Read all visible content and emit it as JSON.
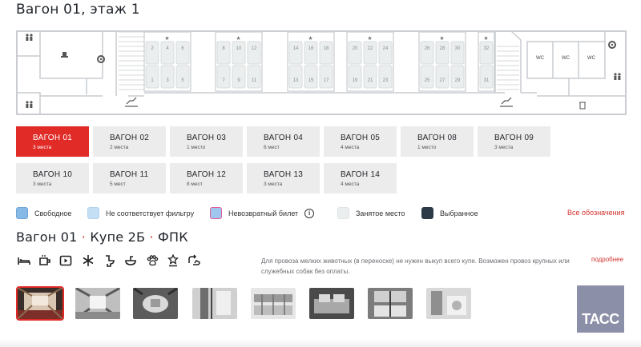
{
  "header": {
    "title": "Вагон 01, этаж 1"
  },
  "car_map": {
    "compartments": [
      {
        "top_seats": [
          "2",
          "4",
          "6"
        ],
        "bottom_seats": [
          "1",
          "3",
          "5"
        ]
      },
      {
        "top_seats": [
          "8",
          "10",
          "12"
        ],
        "bottom_seats": [
          "7",
          "9",
          "11"
        ]
      },
      {
        "top_seats": [
          "14",
          "16",
          "18"
        ],
        "bottom_seats": [
          "13",
          "15",
          "17"
        ]
      },
      {
        "top_seats": [
          "20",
          "22",
          "24"
        ],
        "bottom_seats": [
          "19",
          "21",
          "23"
        ]
      },
      {
        "top_seats": [
          "26",
          "28",
          "30"
        ],
        "bottom_seats": [
          "25",
          "27",
          "29"
        ]
      },
      {
        "top_seats": [
          "32"
        ],
        "bottom_seats": [
          "31"
        ]
      }
    ],
    "wc_labels": [
      "WC",
      "WC",
      "WC"
    ]
  },
  "wagons": [
    {
      "name": "ВАГОН 01",
      "seats": "3 места",
      "active": true
    },
    {
      "name": "ВАГОН 02",
      "seats": "2 места",
      "active": false
    },
    {
      "name": "ВАГОН 03",
      "seats": "1 место",
      "active": false
    },
    {
      "name": "ВАГОН 04",
      "seats": "6 мест",
      "active": false
    },
    {
      "name": "ВАГОН 05",
      "seats": "4 места",
      "active": false
    },
    {
      "name": "ВАГОН 08",
      "seats": "1 место",
      "active": false
    },
    {
      "name": "ВАГОН 09",
      "seats": "3 места",
      "active": false
    },
    {
      "name": "ВАГОН 10",
      "seats": "3 места",
      "active": false
    },
    {
      "name": "ВАГОН 11",
      "seats": "5 мест",
      "active": false
    },
    {
      "name": "ВАГОН 12",
      "seats": "8 мест",
      "active": false
    },
    {
      "name": "ВАГОН 13",
      "seats": "3 места",
      "active": false
    },
    {
      "name": "ВАГОН 14",
      "seats": "4 места",
      "active": false
    }
  ],
  "legend": {
    "items": [
      {
        "label": "Свободное",
        "color": "#86b9e6",
        "border": "#6fa4d6"
      },
      {
        "label": "Не соответствует фильтру",
        "color": "#c4def4",
        "border": "#b2d1ec"
      },
      {
        "label": "Невозвратный билет",
        "color": "#9fc6ec",
        "border": "#e35aa0"
      },
      {
        "label": "Занятое место",
        "color": "#ebeeee",
        "border": "#e0e3e3"
      },
      {
        "label": "Выбранное",
        "color": "#2c3a47",
        "border": "#2c3a47"
      }
    ],
    "info_icon": "info-circle-icon",
    "all_link": "Все обозначения"
  },
  "coupe": {
    "wagon": "Вагон 01",
    "sep": "·",
    "type": "Купе 2Б",
    "carrier": "ФПК"
  },
  "amenities": [
    "bed-icon",
    "cup-icon",
    "play-icon",
    "snowflake-icon",
    "toilet-icon",
    "washbasin-icon",
    "paw-icon",
    "award-icon",
    "transfer-icon"
  ],
  "note": {
    "text": "Для провоза мелких животных (в переноске) не нужен выкуп всего купе. Возможен провоз крупных или служебных собак без оплаты.",
    "more": "подробнее"
  },
  "photos": {
    "count": 8,
    "selected": 0
  },
  "watermark": {
    "text": "ТАСС"
  }
}
